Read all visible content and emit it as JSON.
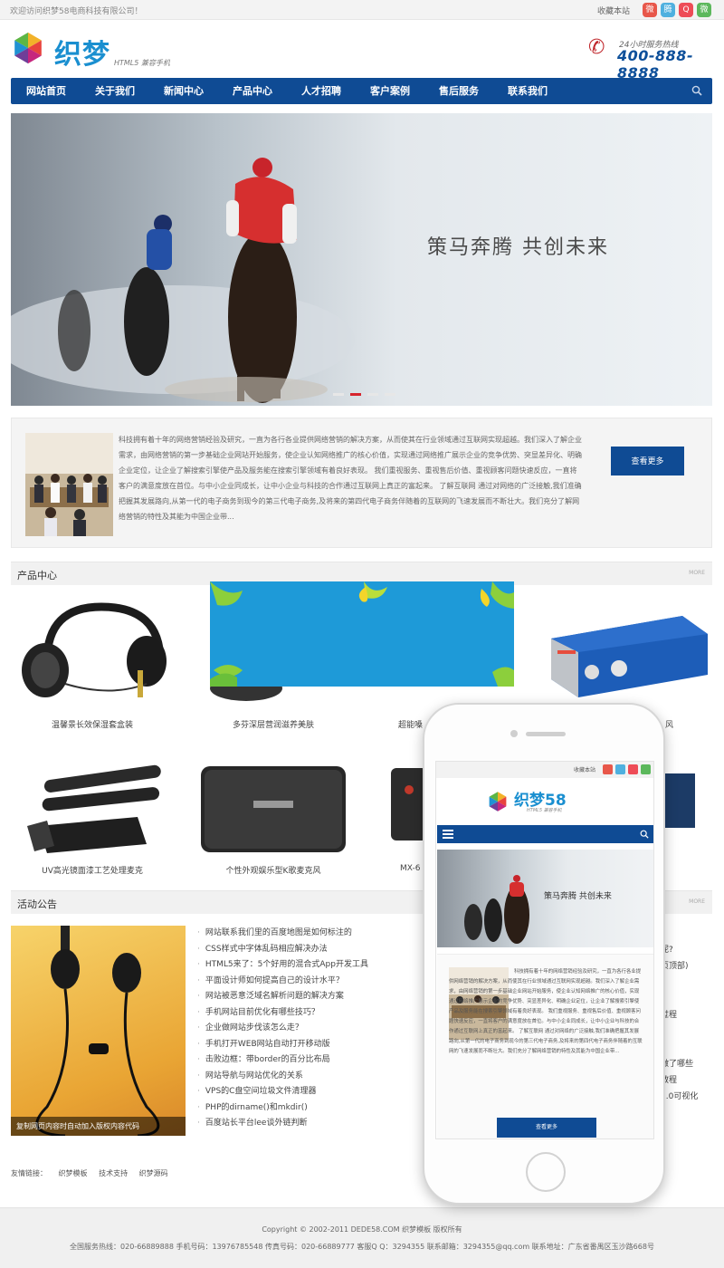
{
  "topbar": {
    "welcome": "欢迎访问织梦58电商科技有限公司！",
    "favorite": "收藏本站",
    "social": [
      {
        "icon": "weibo-icon",
        "color": "#e8574a"
      },
      {
        "icon": "tencent-weibo-icon",
        "color": "#4fb0df"
      },
      {
        "icon": "qq-icon",
        "color": "#ee4c57"
      },
      {
        "icon": "wechat-icon",
        "color": "#5cb85c"
      }
    ]
  },
  "header": {
    "logo_text": "织梦",
    "logo_sub": "HTML5 兼容手机",
    "hotline_label": "24小时服务热线",
    "hotline_number": "400-888-8888"
  },
  "nav": {
    "items": [
      "网站首页",
      "关于我们",
      "新闻中心",
      "产品中心",
      "人才招聘",
      "客户案例",
      "售后服务",
      "联系我们"
    ]
  },
  "banner": {
    "slogan": "策马奔腾 共创未来",
    "slides": 4,
    "active_slide": 2
  },
  "about": {
    "text": "科技拥有着十年的网络营销经验及研究，一直为各行各业提供网络营销的解决方案，从而使其在行业领域通过互联网实现超越。我们深入了解企业需求，由网络营销的第一步基础企业网站开始服务，使企业认知网络推广的核心价值，实现通过网络推广展示企业的竞争优势、突显差异化、明确企业定位，让企业了解搜索引擎使产品及服务能在搜索引擎领域有着良好表现。 我们重视服务、重视售后价值、重视顾客问题快速反应，一直将客户的满意度放在首位。与中小企业同成长，让中小企业与科技的合作通过互联网上真正的富起来。 了解互联网 通过对网络的广泛接触,我们准确把握其发展路向,从第一代的电子商务到现今的第三代电子商务,及将来的第四代电子商务伴随着的互联网的飞速发展而不断壮大。我们充分了解网络营销的特性及其能为中国企业带...",
    "button": "查看更多"
  },
  "products": {
    "title": "产品中心",
    "more": "MORE",
    "row1": [
      "温馨景长效保湿套盒装",
      "多芬深层营润滋养美肤",
      "超能嗓",
      "风"
    ],
    "row2": [
      "UV高光镜面漆工艺处理麦克",
      "个性外观娱乐型K歌麦克风",
      "MX-6",
      ""
    ]
  },
  "news": {
    "title": "活动公告",
    "more": "MORE",
    "image_caption": "复制网页内容时自动加入版权内容代码",
    "items": [
      "网站联系我们里的百度地图是如何标注的",
      "CSS样式中字体乱码相应解决办法",
      "HTML5来了：5个好用的混合式App开发工具",
      "平面设计师如何提高自己的设计水平？",
      "网站被恶意泛域名解析问题的解决方案",
      "手机网站目前优化有哪些技巧？",
      "企业做网站步伐该怎么走？",
      "手机打开WEB网站自动打开移动版",
      "击败边框：带border的百分比布局",
      "网站导航与网站优化的关系",
      "VPS的C盘空间垃圾文件清理器",
      "PHP的dirname()和mkdir()",
      "百度站长平台lee谈外链判断"
    ],
    "right_fragments": [
      "呢?",
      "页顶部)",
      "s",
      "过程",
      "做了哪些",
      "教程",
      "2.0可视化"
    ]
  },
  "links": {
    "label": "友情链接：",
    "items": [
      "织梦模板",
      "技术支持",
      "织梦源码"
    ]
  },
  "footer": {
    "copyright": "Copyright © 2002-2011 DEDE58.COM 织梦模板 版权所有",
    "contact": "全国服务热线：020-66889888 手机号码：13976785548 传真号码：020-66889777 客服Q Q：3294355 联系邮箱：3294355@qq.com 联系地址：广东省番禺区玉沙路668号"
  },
  "mobile": {
    "favorite": "收藏本站",
    "logo_text": "织梦58",
    "logo_sub": "HTML5 兼容手机",
    "slogan": "策马奔腾 共创未来",
    "about_text": "科技拥有着十年的网络营销经验及研究，一直为各行各业提供网络营销的解决方案，从而使其在行业领域通过互联网实现超越。我们深入了解企业需求，由网络营销的第一步基础企业网站开始服务，使企业认知网络推广的核心价值，实现通过网络推广展示企业的竞争优势、突显差异化、明确企业定位，让企业了解搜索引擎使产品及服务能在搜索引擎领域有着良好表现。 我们重视服务、重视售后价值、重视顾客问题快速反应，一直将客户的满意度放在首位。与中小企业同成长，让中小企业与科技的合作通过互联网上真正的富起来。 了解互联网 通过对网络的广泛接触,我们准确把握其发展路向,从第一代的电子商务到现今的第三代电子商务,及将来的第四代电子商务伴随着的互联网的飞速发展而不断壮大。我们充分了解网络营销的特性及其能为中国企业带...",
    "button": "查看更多"
  }
}
